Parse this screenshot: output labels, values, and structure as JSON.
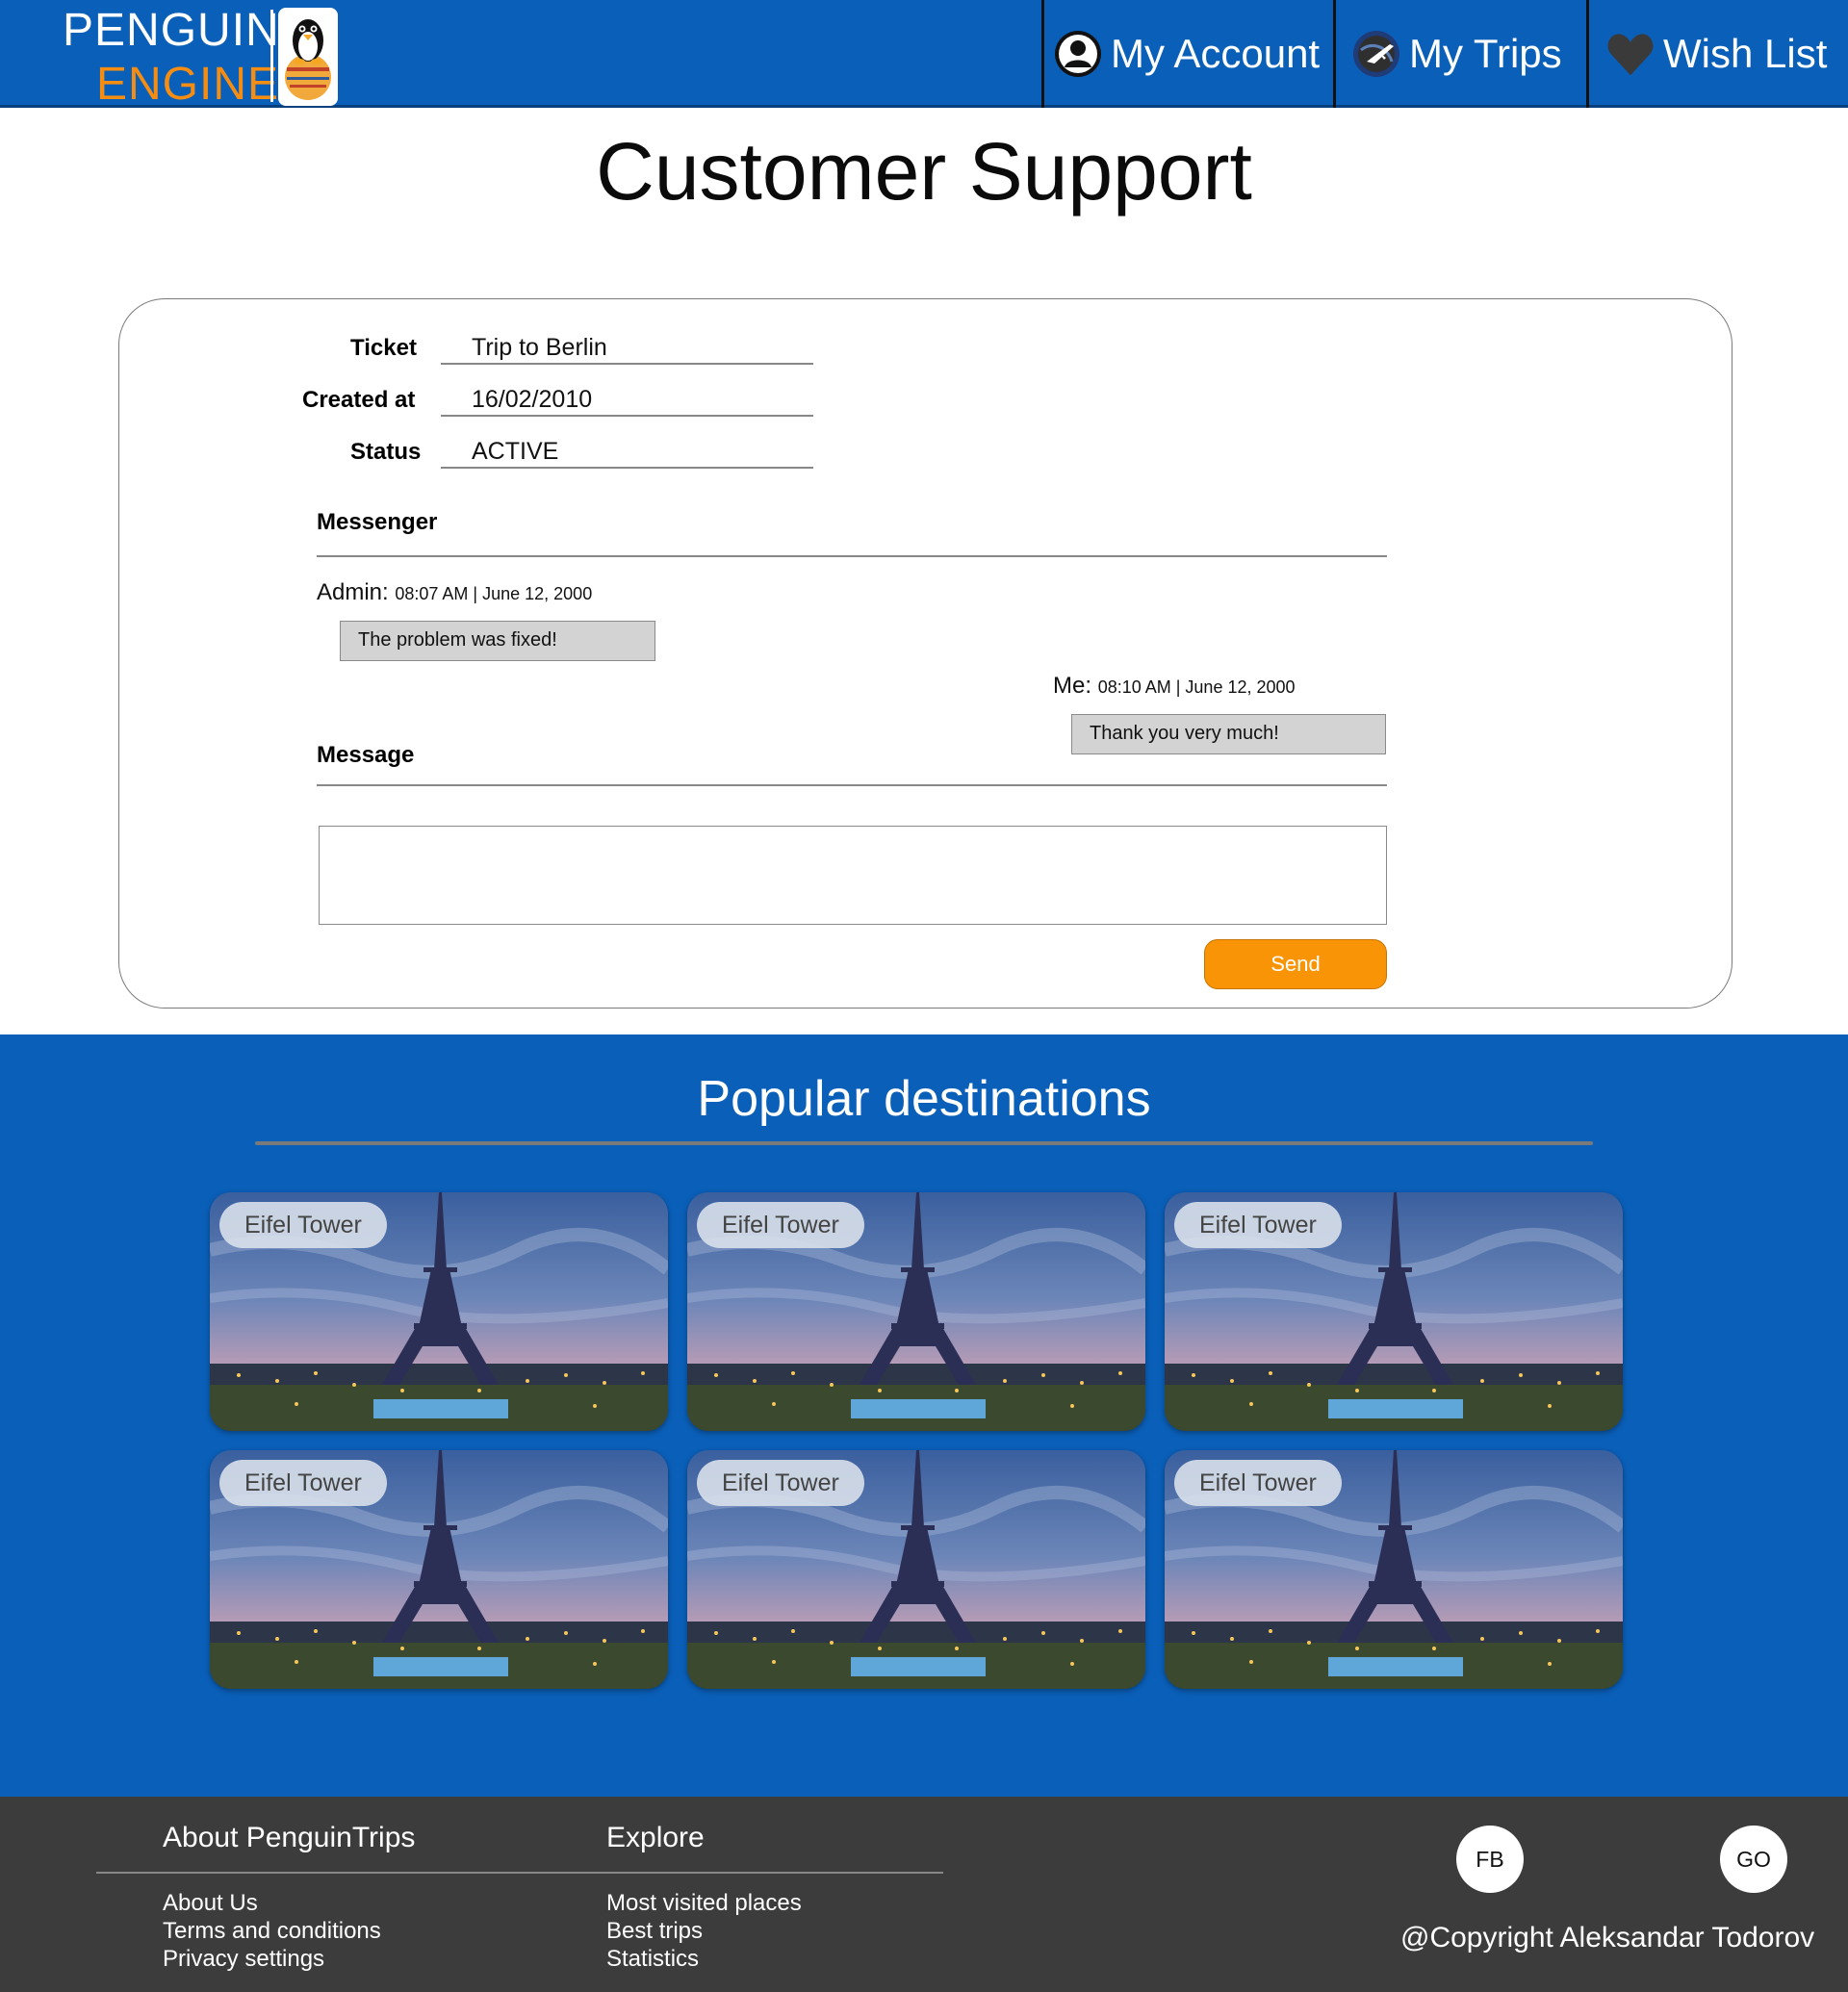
{
  "header": {
    "brand_line1": "PENGUIN",
    "brand_line2": "ENGINE",
    "nav": [
      {
        "label": "My Account",
        "icon": "user-circle-icon"
      },
      {
        "label": "My Trips",
        "icon": "globe-plane-icon"
      },
      {
        "label": "Wish List",
        "icon": "heart-icon"
      }
    ]
  },
  "page_title": "Customer Support",
  "ticket": {
    "ticket_label": "Ticket",
    "ticket_value": "Trip to Berlin",
    "created_label": "Created at",
    "created_value": "16/02/2010",
    "status_label": "Status",
    "status_value": "ACTIVE",
    "messenger_label": "Messenger",
    "messages": [
      {
        "author": "Admin:",
        "time": "08:07 AM | June 12, 2000",
        "text": "The problem was fixed!"
      },
      {
        "author": "Me:",
        "time": "08:10 AM | June 12, 2000",
        "text": "Thank you very much!"
      }
    ],
    "message_label": "Message",
    "message_value": "",
    "send_label": "Send"
  },
  "popular": {
    "title": "Popular destinations",
    "destinations": [
      {
        "name": "Eifel Tower"
      },
      {
        "name": "Eifel Tower"
      },
      {
        "name": "Eifel Tower"
      },
      {
        "name": "Eifel Tower"
      },
      {
        "name": "Eifel Tower"
      },
      {
        "name": "Eifel Tower"
      }
    ]
  },
  "footer": {
    "about_heading": "About PenguinTrips",
    "about_links": [
      "About Us",
      "Terms and conditions",
      "Privacy settings"
    ],
    "explore_heading": "Explore",
    "explore_links": [
      "Most visited places",
      "Best trips",
      "Statistics"
    ],
    "social": [
      "FB",
      "GO"
    ],
    "copyright": "@Copyright Aleksandar Todorov"
  },
  "colors": {
    "primary_blue": "#0a5fb8",
    "accent_orange": "#f89406",
    "footer_bg": "#3c3c3c"
  }
}
